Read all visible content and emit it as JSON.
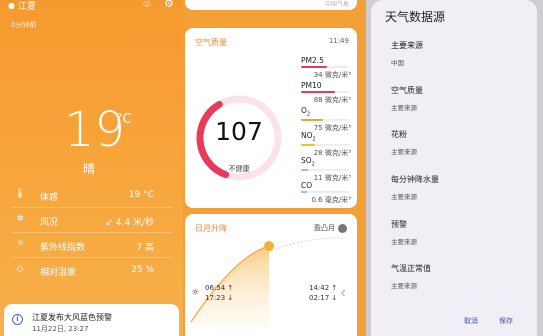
{
  "weather": {
    "city": "江夏",
    "updated": "0分钟前",
    "temperature": "19",
    "degree_unit": "°C",
    "condition": "晴",
    "details": [
      {
        "icon": "thermometer-icon",
        "glyph": "🌡",
        "label": "体感",
        "value": "19 °C"
      },
      {
        "icon": "fan-icon",
        "glyph": "✲",
        "label": "风况",
        "value": "↙ 4.4 米/秒"
      },
      {
        "icon": "sun-icon",
        "glyph": "☼",
        "label": "紫外线指数",
        "value": "7 高"
      },
      {
        "icon": "droplet-icon",
        "glyph": "◇",
        "label": "相对湿度",
        "value": "25 %"
      }
    ],
    "alert": {
      "title": "江夏发布大风蓝色预警",
      "date": "11月22日, 23:27"
    }
  },
  "cards": {
    "top_faint": "中国气象",
    "air": {
      "title": "空气质量",
      "time": "11:49",
      "aqi": "107",
      "aqi_label": "不健康",
      "aqi_fraction": 0.36,
      "pollutants": [
        {
          "name": "PM2.5",
          "sub": "",
          "value": "34 微克/米³",
          "color": "#e83a5a",
          "fill": 0.55
        },
        {
          "name": "PM10",
          "sub": "",
          "value": "88 微克/米³",
          "color": "#e83a5a",
          "fill": 0.7
        },
        {
          "name": "O",
          "sub": "2",
          "value": "75 微克/米³",
          "color": "#e8a33a",
          "fill": 0.45
        },
        {
          "name": "NO",
          "sub": "2",
          "value": "28 微克/米³",
          "color": "#f1c232",
          "fill": 0.3
        },
        {
          "name": "SO",
          "sub": "2",
          "value": "11 微克/米³",
          "color": "#7cd1c6",
          "fill": 0.15
        },
        {
          "name": "CO",
          "sub": "",
          "value": "0.6 毫克/米³",
          "color": "#7cd1c6",
          "fill": 0.12
        }
      ]
    },
    "sun": {
      "title": "日月升降",
      "moon_phase": "盈凸月",
      "sunrise": "06:54",
      "sunset": "17:23",
      "moonrise": "14:42",
      "moonset": "02:17",
      "arrow_up": "↑",
      "arrow_down": "↓"
    }
  },
  "dialog": {
    "title": "天气数据源",
    "options": [
      {
        "label": "主要来源",
        "source": "中国"
      },
      {
        "label": "空气质量",
        "source": "主要来源"
      },
      {
        "label": "花粉",
        "source": "主要来源"
      },
      {
        "label": "每分钟降水量",
        "source": "主要来源"
      },
      {
        "label": "预警",
        "source": "主要来源"
      },
      {
        "label": "气温正常值",
        "source": "主要来源"
      }
    ],
    "cancel": "取消",
    "save": "保存"
  },
  "colors": {
    "orange": "#f59a2f",
    "accent_red": "#e83a5a",
    "link_blue": "#3f51b5"
  }
}
